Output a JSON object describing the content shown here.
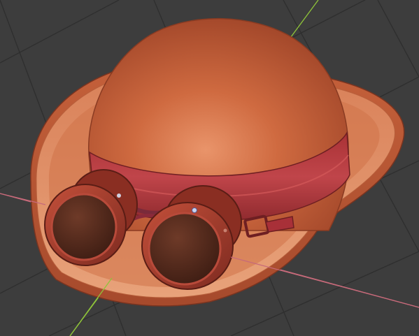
{
  "viewport": {
    "kind": "3d-viewport",
    "background_color": "#3d3d3d",
    "grid_color": "#2e2e2e",
    "x_axis_color": "#c76a7a",
    "y_axis_color": "#8fc43a"
  },
  "model": {
    "subject": "bowler-hat-with-goggles",
    "hat_color": "#c8603a",
    "band_color": "#b0303a",
    "goggle_frame_color": "#a83a2a",
    "lens_color": "#4a2518"
  }
}
